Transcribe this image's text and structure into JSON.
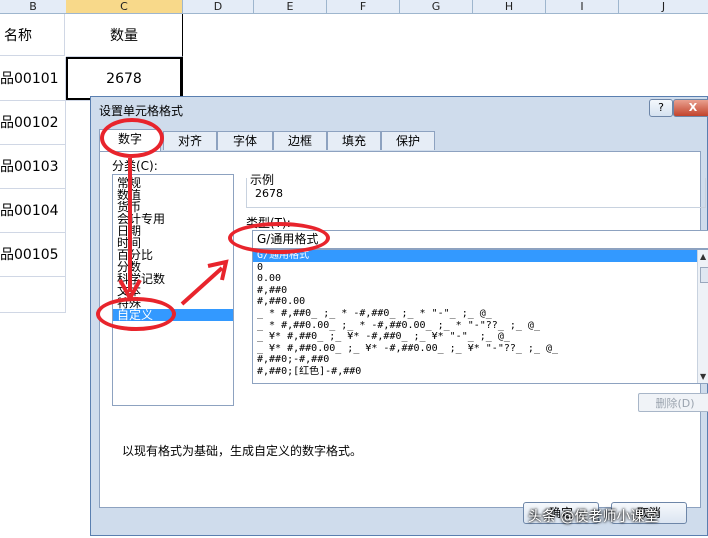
{
  "sheet": {
    "columns": [
      "B",
      "C",
      "D",
      "E",
      "F",
      "G",
      "H",
      "I",
      "J"
    ],
    "header_cells": {
      "name": "名称",
      "qty": "数量"
    },
    "rows": [
      {
        "name": "品00101",
        "qty": "2678"
      },
      {
        "name": "品00102",
        "qty": ""
      },
      {
        "name": "品00103",
        "qty": ""
      },
      {
        "name": "品00104",
        "qty": ""
      },
      {
        "name": "品00105",
        "qty": ""
      }
    ]
  },
  "dialog": {
    "title": "设置单元格格式",
    "help": "?",
    "close": "X",
    "tabs": [
      "数字",
      "对齐",
      "字体",
      "边框",
      "填充",
      "保护"
    ],
    "category_label": "分类(C):",
    "categories": [
      "常规",
      "数值",
      "货币",
      "会计专用",
      "日期",
      "时间",
      "百分比",
      "分数",
      "科学记数",
      "文本",
      "特殊",
      "自定义"
    ],
    "selected_category": "自定义",
    "sample_label": "示例",
    "sample_value": "2678",
    "type_label": "类型(T):",
    "type_value": "G/通用格式",
    "formats": [
      "G/通用格式",
      "0",
      "0.00",
      "#,##0",
      "#,##0.00",
      "_ * #,##0_ ;_ * -#,##0_ ;_ * \"-\"_ ;_ @_",
      "_ * #,##0.00_ ;_ * -#,##0.00_ ;_ * \"-\"??_ ;_ @_",
      "_ ¥* #,##0_ ;_ ¥* -#,##0_ ;_ ¥* \"-\"_ ;_ @_",
      "_ ¥* #,##0.00_ ;_ ¥* -#,##0.00_ ;_ ¥* \"-\"??_ ;_ @_",
      "#,##0;-#,##0",
      "#,##0;[红色]-#,##0"
    ],
    "delete_button": "删除(D)",
    "description": "以现有格式为基础，生成自定义的数字格式。",
    "ok_button": "确定",
    "cancel_button": "取消"
  },
  "watermark": "头条 @侯老师小课堂",
  "colors": {
    "annotation": "#e8242c",
    "selection": "#3399ff",
    "dialog_bg": "#cfdcec"
  }
}
